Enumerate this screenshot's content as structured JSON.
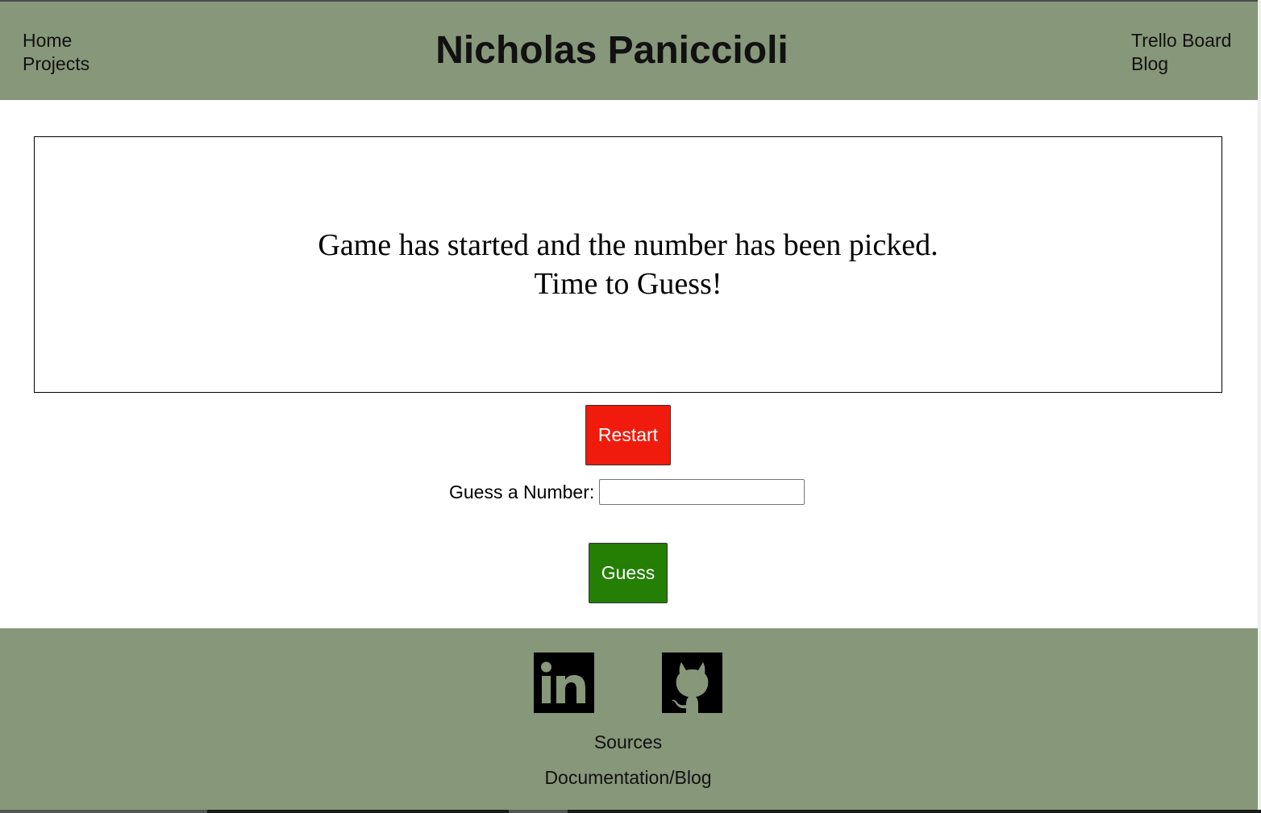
{
  "header": {
    "title": "Nicholas Paniccioli",
    "nav_left": [
      "Home",
      "Projects"
    ],
    "nav_right": [
      "Trello Board",
      "Blog"
    ],
    "background_color": "#87977a"
  },
  "game": {
    "message_line1": "Game has started and the number has been picked.",
    "message_line2": "Time to Guess!"
  },
  "controls": {
    "restart_label": "Restart",
    "restart_color": "#f01b0c",
    "guess_label": "Guess a Number:",
    "guess_value": "",
    "guess_button_label": "Guess",
    "guess_button_color": "#247f04"
  },
  "footer": {
    "icons": [
      "linkedin-icon",
      "github-icon"
    ],
    "links": [
      "Sources",
      "Documentation/Blog"
    ],
    "background_color": "#87977a"
  }
}
